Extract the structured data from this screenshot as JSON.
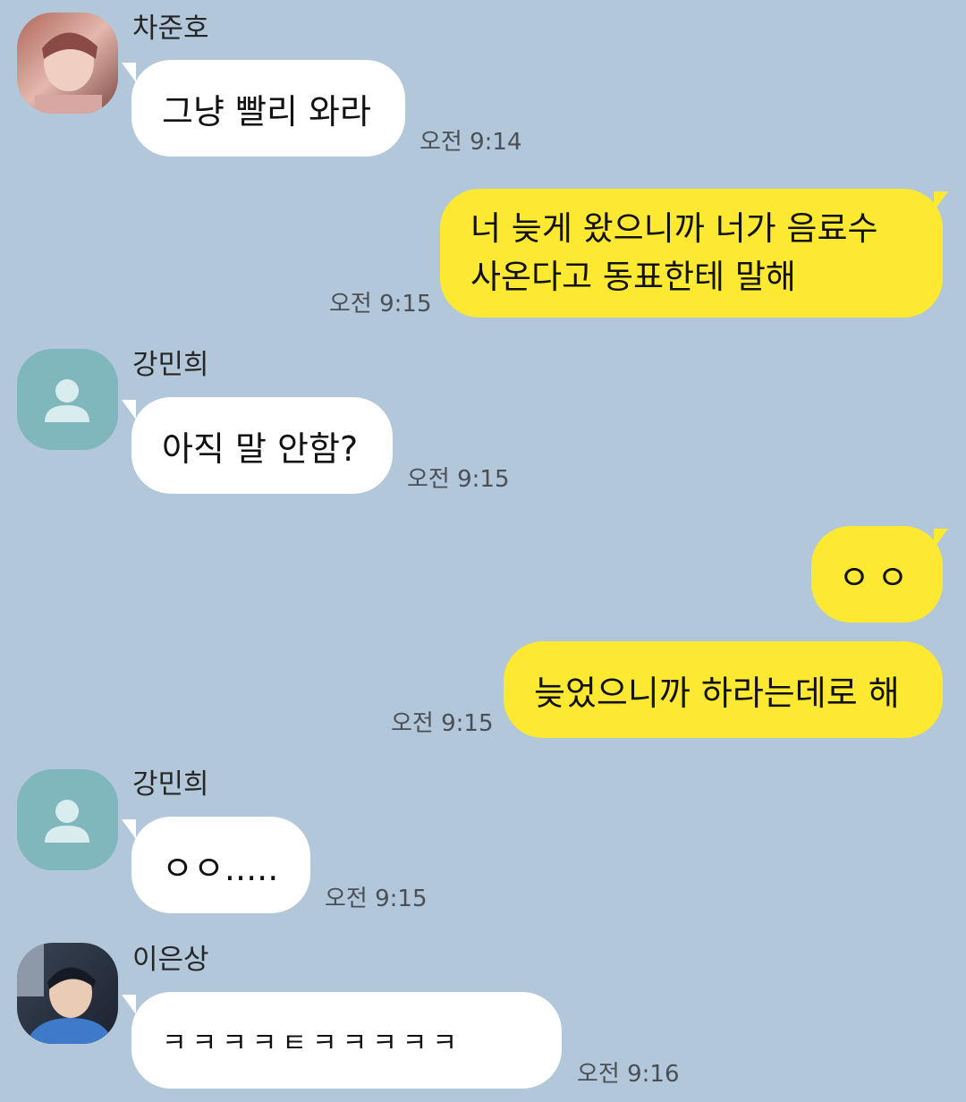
{
  "messages": [
    {
      "sender": "차준호",
      "text": "그냥 빨리 와라",
      "time": "오전 9:14",
      "avatar": "photo-avatar"
    },
    {
      "sender": "me",
      "text": "너 늦게 왔으니까 너가 음료수 사온다고 동표한테 말해",
      "time": "오전 9:15"
    },
    {
      "sender": "강민희",
      "text": "아직 말 안함?",
      "time": "오전 9:15",
      "avatar": "default-person-icon"
    },
    {
      "sender": "me",
      "text": "ㅇㅇ",
      "time": ""
    },
    {
      "sender": "me",
      "text": "늦었으니까 하라는데로 해",
      "time": "오전 9:15"
    },
    {
      "sender": "강민희",
      "text": "ㅇㅇ.....",
      "time": "오전 9:15",
      "avatar": "default-person-icon"
    },
    {
      "sender": "이은상",
      "text": "ㅋㅋㅋㅋㅌㅋㅋㅋㅋㅋ",
      "time": "오전 9:16",
      "avatar": "photo-avatar"
    }
  ],
  "colors": {
    "background": "#b2c7d9",
    "incoming_bubble": "#ffffff",
    "outgoing_bubble": "#fee932",
    "default_avatar": "#7fb7bd"
  }
}
